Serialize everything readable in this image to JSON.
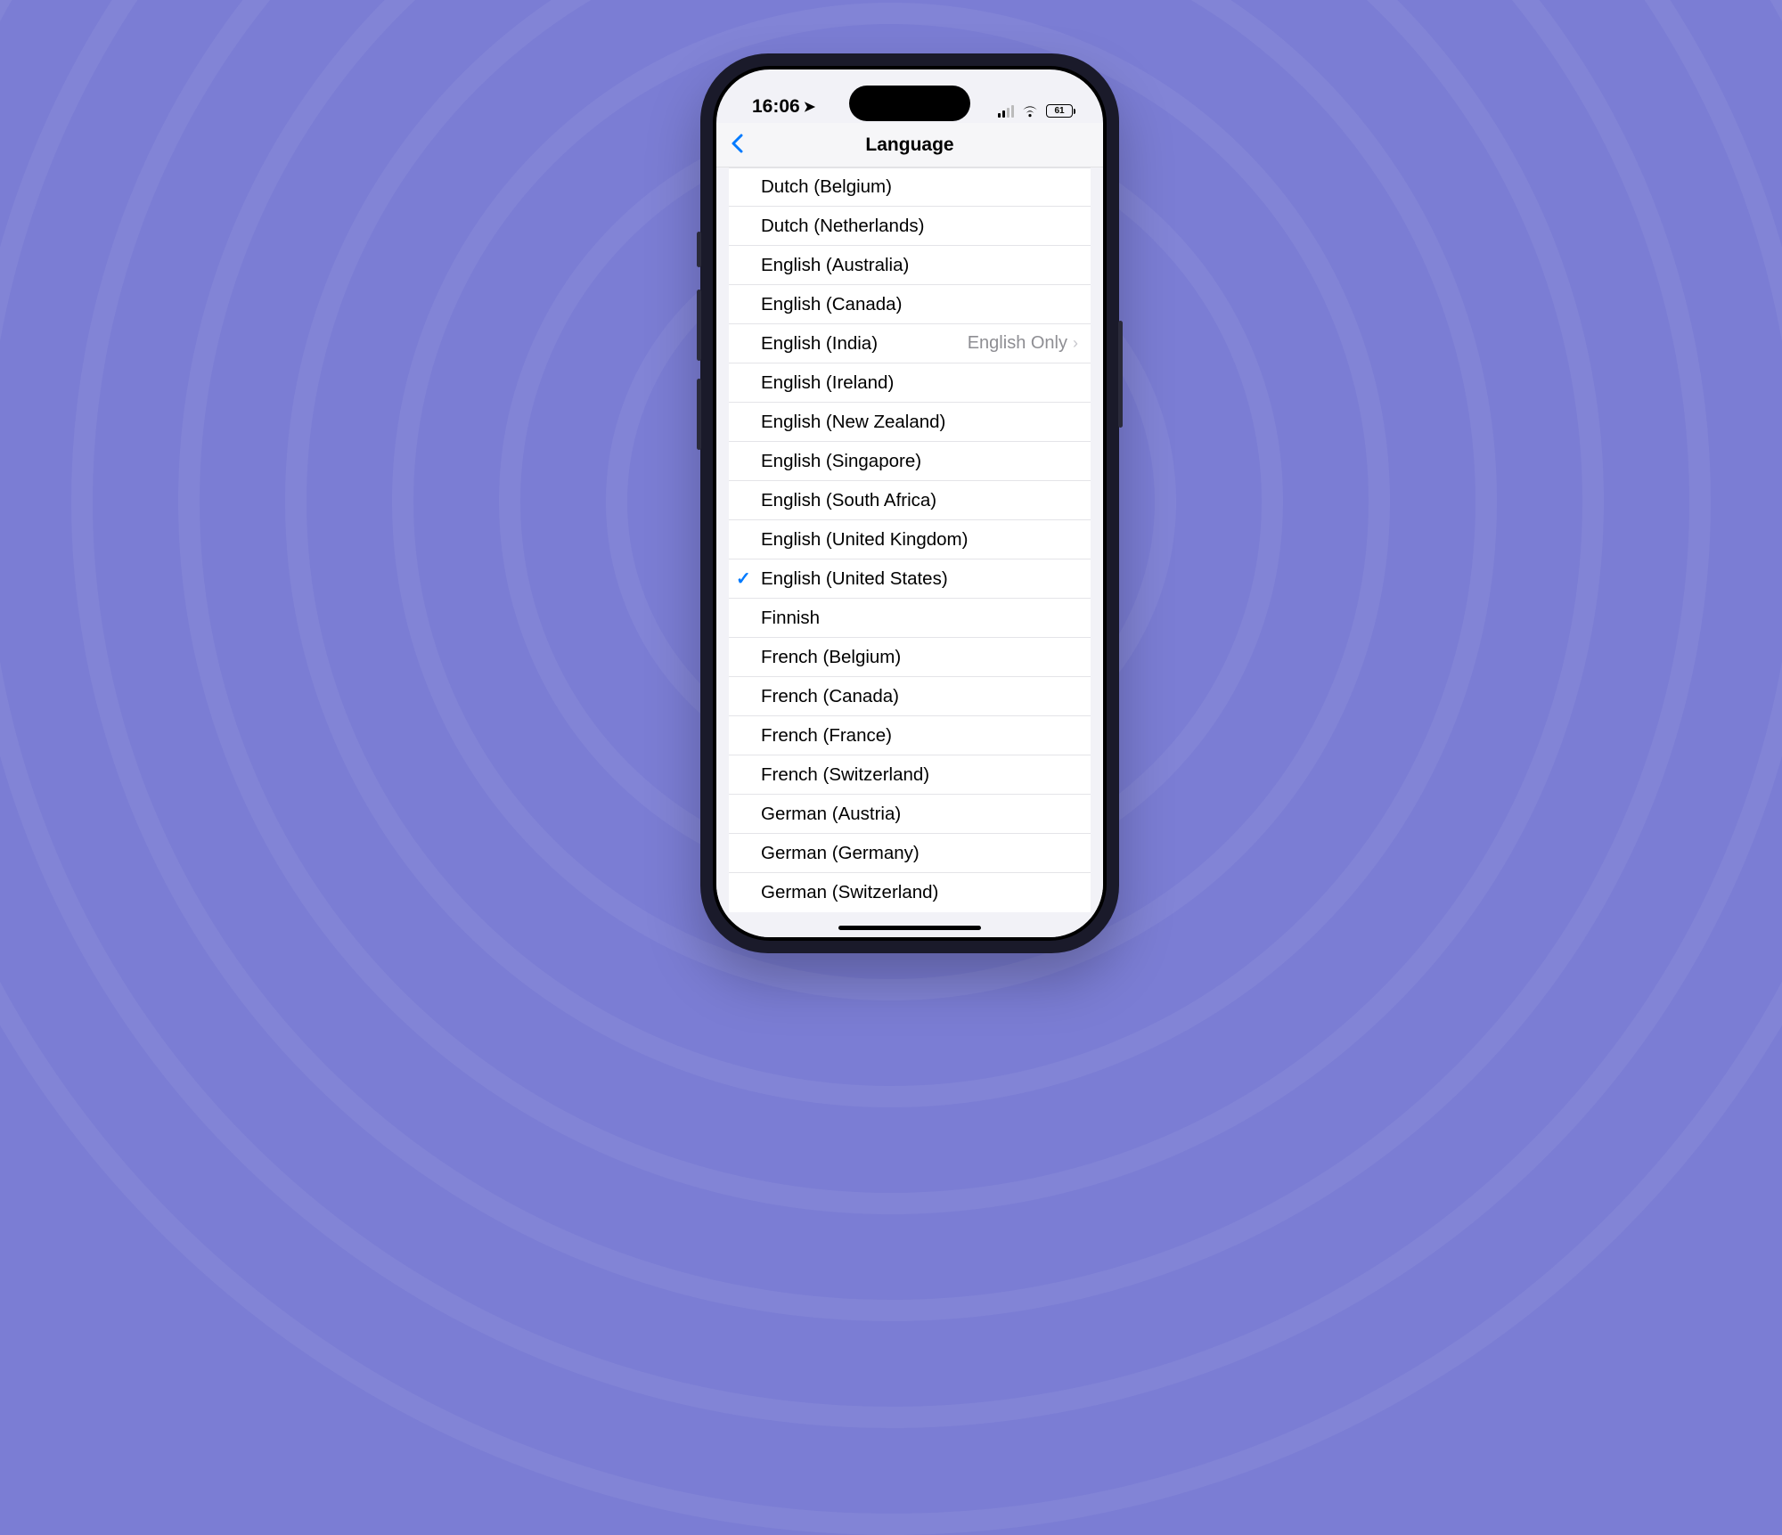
{
  "status": {
    "time": "16:06",
    "battery": "61"
  },
  "nav": {
    "title": "Language"
  },
  "languages": [
    {
      "label": "Dutch (Belgium)"
    },
    {
      "label": "Dutch (Netherlands)"
    },
    {
      "label": "English (Australia)"
    },
    {
      "label": "English (Canada)"
    },
    {
      "label": "English (India)",
      "detail": "English Only",
      "disclosure": true
    },
    {
      "label": "English (Ireland)"
    },
    {
      "label": "English (New Zealand)"
    },
    {
      "label": "English (Singapore)"
    },
    {
      "label": "English (South Africa)"
    },
    {
      "label": "English (United Kingdom)"
    },
    {
      "label": "English (United States)",
      "selected": true
    },
    {
      "label": "Finnish"
    },
    {
      "label": "French (Belgium)"
    },
    {
      "label": "French (Canada)"
    },
    {
      "label": "French (France)"
    },
    {
      "label": "French (Switzerland)"
    },
    {
      "label": "German (Austria)"
    },
    {
      "label": "German (Germany)"
    },
    {
      "label": "German (Switzerland)"
    }
  ]
}
